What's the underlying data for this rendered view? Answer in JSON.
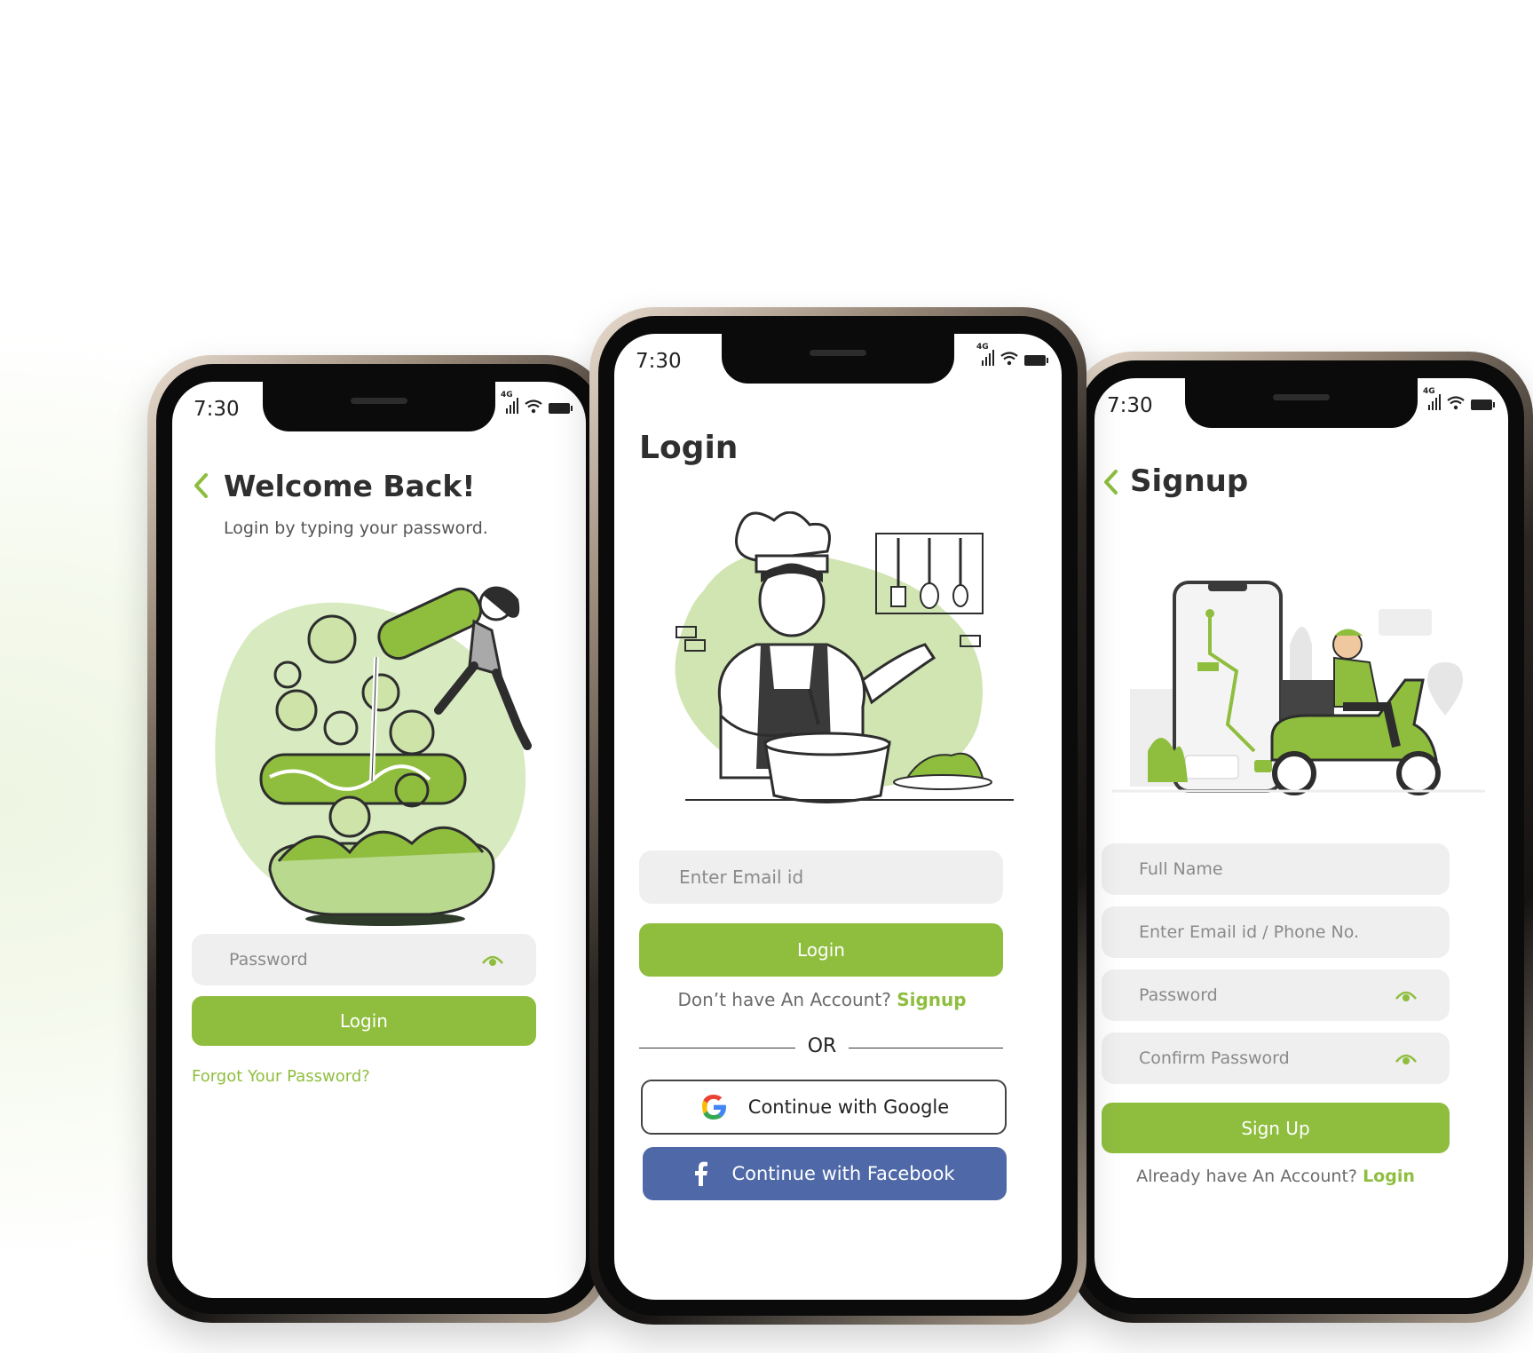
{
  "colors": {
    "accent": "#8fbe3f",
    "facebook": "#4f69a8",
    "field_bg": "#efefef"
  },
  "status_bar": {
    "time": "7:30",
    "network": "4G"
  },
  "welcome_screen": {
    "title": "Welcome Back!",
    "subtitle": "Login by typing your password.",
    "back_icon": "chevron-left-icon",
    "password_placeholder": "Password",
    "login_label": "Login",
    "forgot_label": "Forgot Your Password?"
  },
  "login_screen": {
    "title": "Login",
    "email_placeholder": "Enter Email id",
    "login_label": "Login",
    "no_account_text": "Don’t have An Account?",
    "signup_link": "Signup",
    "or_label": "OR",
    "google_label": "Continue with Google",
    "facebook_label": "Continue with Facebook"
  },
  "signup_screen": {
    "title": "Signup",
    "back_icon": "chevron-left-icon",
    "fullname_placeholder": "Full Name",
    "email_placeholder": "Enter Email id / Phone No.",
    "password_placeholder": "Password",
    "confirm_placeholder": "Confirm Password",
    "signup_label": "Sign Up",
    "have_account_text": "Already have An Account?",
    "login_link": "Login"
  }
}
